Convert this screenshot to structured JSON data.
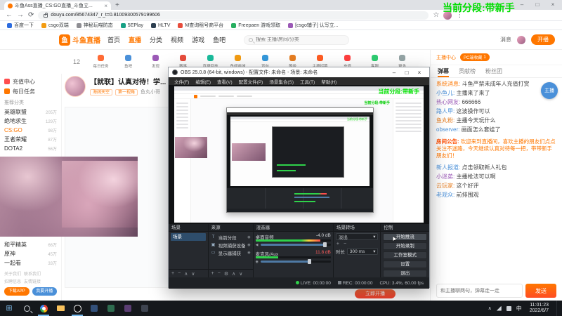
{
  "overlay": {
    "segment_text": "当前分段:带新手",
    "segment_color": "#00dd00"
  },
  "icons": {
    "back": "←",
    "forward": "→",
    "refresh": "⟳",
    "star": "☆",
    "menu": "⋮",
    "close": "×",
    "minimize": "–",
    "maximize": "□",
    "plus": "+",
    "minus": "−",
    "up": "∧",
    "down": "∨",
    "more": "⋯",
    "eye": "◉",
    "lock": "●",
    "speaker": "◀",
    "mic": "◉",
    "dropdown": "▾",
    "chevron_up": "∧",
    "win": "⊞",
    "newtab": "+",
    "gear": "⚙",
    "cursor": "▲"
  },
  "browser": {
    "tab": {
      "title": "斗鱼Ass直播_CS:GO直播_斗鱼立..."
    },
    "url": "douyu.com/85674347_r_t=0.81009300579199606",
    "bookmarks": [
      "百度一下",
      "csgo双端",
      "神秘玩喵防态",
      "5EPlay",
      "HLTV",
      "M查询租号商平台",
      "Freepaen 游戏领取",
      "[csgo辅子] 认写立..."
    ]
  },
  "douyu": {
    "logo": "斗鱼直播",
    "logo_glyph": "鱼",
    "nav": [
      "首页",
      "直播",
      "分类",
      "视频",
      "游戏",
      "鱼吧"
    ],
    "search_placeholder": "搜索 主播/房间/分类",
    "header": {
      "message": "消息",
      "start_live": "开播"
    },
    "sub_header": {
      "fans": "12",
      "anchor_center": "主播中心",
      "collect": "PC端收藏",
      "collect_count": "1"
    },
    "quick_icons": [
      {
        "label": "每日任务",
        "color": "#ff6b35"
      },
      {
        "label": "鱼吧",
        "color": "#4a90d9"
      },
      {
        "label": "发现",
        "color": "#9b59b6"
      },
      {
        "label": "赛事",
        "color": "#e74c3c"
      },
      {
        "label": "直播回放",
        "color": "#1abc9c"
      },
      {
        "label": "鱼翅商城",
        "color": "#f39c12"
      },
      {
        "label": "背包",
        "color": "#3498db"
      },
      {
        "label": "等级",
        "color": "#e67e22"
      },
      {
        "label": "主播招募",
        "color": "#ff5d23"
      },
      {
        "label": "充值",
        "color": "#ff3f3f"
      },
      {
        "label": "客服",
        "color": "#2ecc71"
      },
      {
        "label": "更多",
        "color": "#95a5a6"
      }
    ],
    "sidebar": {
      "feature_items": [
        {
          "label": "充值中心"
        },
        {
          "label": "每日任务"
        }
      ],
      "section_title": "推荐分类",
      "categories_top": [
        {
          "name": "英雄联盟",
          "count": "205万"
        },
        {
          "name": "绝地求生",
          "count": "129万"
        },
        {
          "name": "CS:GO",
          "count": "98万"
        },
        {
          "name": "王者荣耀",
          "count": "87万"
        },
        {
          "name": "DOTA2",
          "count": "56万"
        }
      ],
      "categories_bottom": [
        {
          "name": "和平精英",
          "count": "66万"
        },
        {
          "name": "原神",
          "count": "45万"
        },
        {
          "name": "一起看",
          "count": "33万"
        }
      ],
      "footer_links": [
        "关于我们",
        "联系我们",
        "招聘信息",
        "友情链接"
      ],
      "app_button": "下载APP",
      "live_button": "我要开播"
    },
    "stream": {
      "title": "【就联】认真对待！学...",
      "tags": [
        "海阔天空",
        "第一视角"
      ],
      "streamer": "鱼丸小哥",
      "start_button": "立即开播"
    },
    "chat": {
      "tabs": [
        "弹幕",
        "贡献榜",
        "粉丝团"
      ],
      "badge": "主播",
      "messages": [
        {
          "user": "系统消息:",
          "text": "斗鱼严禁未成年人充值打赏",
          "color": "#ff7700"
        },
        {
          "user": "小鱼儿:",
          "text": "主播来了来了",
          "color": "#4a90d9"
        },
        {
          "user": "热心网友:",
          "text": "666666",
          "color": "#9b59b6"
        },
        {
          "user": "路人甲:",
          "text": "这波操作可以",
          "color": "#4a90d9"
        },
        {
          "user": "鱼丸粉:",
          "text": "主播今天玩什么",
          "color": "#e67e22"
        },
        {
          "user": "observer:",
          "text": "画面怎么套娃了",
          "color": "#4a90d9"
        }
      ],
      "announcement_title": "房间公告:",
      "announcement": "欢迎来到直播间，喜欢主播的朋友们点点关注不迷路，今天继续认真对待每一把，带带新手朋友们！",
      "messages2": [
        {
          "user": "新人报道:",
          "text": "点击领取新人礼包",
          "color": "#4a90d9"
        },
        {
          "user": "小迷弟:",
          "text": "主播枪法可以啊",
          "color": "#9b59b6"
        },
        {
          "user": "云玩家:",
          "text": "这个好评",
          "color": "#e67e22"
        },
        {
          "user": "老观众:",
          "text": "前排围观",
          "color": "#4a90d9"
        }
      ],
      "input_placeholder": "和主播聊两句，弹幕走一走",
      "send_button": "发送"
    }
  },
  "obs": {
    "window_title": "OBS 25.0.8 (64-bit, windows) - 配置文件: 未命名 - 场景: 未命名",
    "menus": [
      "文件(F)",
      "编辑(E)",
      "查看(V)",
      "配置文件(P)",
      "场景集合(S)",
      "工具(T)",
      "帮助(H)"
    ],
    "preview_overlay_text": "当前分段:带新手",
    "scenes": {
      "title": "场景",
      "items": [
        "场景"
      ]
    },
    "sources": {
      "title": "来源",
      "items": [
        {
          "name": "当前分段",
          "glyph": "T"
        },
        {
          "name": "视频捕获设备",
          "glyph": "▣"
        },
        {
          "name": "显示器捕获",
          "glyph": "▭"
        }
      ]
    },
    "mixer": {
      "title": "混音器",
      "channels": [
        {
          "name": "桌面音频",
          "db": "-4.0 dB"
        },
        {
          "name": "麦克风/Aux",
          "db": "11.8 dB"
        }
      ]
    },
    "transitions": {
      "title": "场景转场",
      "selected": "淡出",
      "duration_label": "时长",
      "duration_value": "300 ms"
    },
    "controls": {
      "title": "控制",
      "buttons": [
        "开始推流",
        "开始录制",
        "工作室模式",
        "设置",
        "退出"
      ]
    },
    "status": {
      "live": "LIVE: 00:00:00",
      "rec": "REC: 00:00:00",
      "cpu": "CPU: 3.4%, 60.00 fps"
    }
  },
  "taskbar": {
    "time": "11:01:23",
    "date": "2022/6/7",
    "input_method": "中"
  }
}
